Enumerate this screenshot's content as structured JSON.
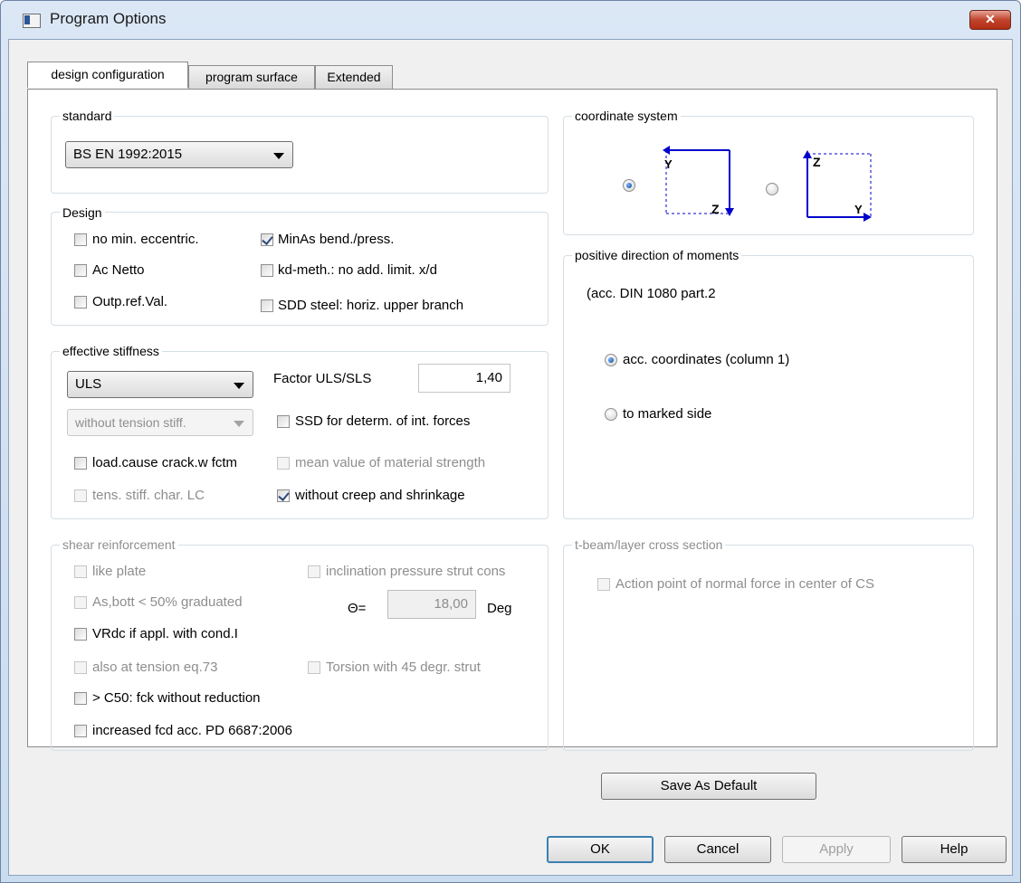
{
  "window": {
    "title": "Program Options",
    "close_label": "✕"
  },
  "tabs": [
    {
      "label": "design configuration"
    },
    {
      "label": "program surface"
    },
    {
      "label": "Extended"
    }
  ],
  "standard": {
    "label": "standard",
    "value": "BS EN 1992:2015"
  },
  "design": {
    "label": "Design",
    "items": [
      {
        "label": "no min. eccentric.",
        "checked": false
      },
      {
        "label": "MinAs bend./press.",
        "checked": true
      },
      {
        "label": "Ac Netto",
        "checked": false
      },
      {
        "label": "kd-meth.: no add. limit. x/d",
        "checked": false
      },
      {
        "label": "Outp.ref.Val.",
        "checked": false
      },
      {
        "label": "SDD steel: horiz. upper branch",
        "checked": false
      }
    ]
  },
  "effective_stiffness": {
    "label": "effective stiffness",
    "combo1": "ULS",
    "factor_label": "Factor ULS/SLS",
    "factor_value": "1,40",
    "combo2": "without tension stiff.",
    "items": [
      {
        "label": "SSD for determ. of int. forces",
        "checked": false
      },
      {
        "label": "load.cause crack.w fctm",
        "checked": false
      },
      {
        "label": "mean value of material strength",
        "checked": false
      },
      {
        "label": "tens. stiff. char. LC",
        "checked": false
      },
      {
        "label": "without creep and shrinkage",
        "checked": true
      }
    ]
  },
  "shear": {
    "label": "shear reinforcement",
    "items": [
      {
        "label": "like plate",
        "checked": false
      },
      {
        "label": "inclination pressure strut cons",
        "checked": false
      },
      {
        "label": "As,bott < 50% graduated",
        "checked": false
      },
      {
        "label": "VRdc if appl. with cond.I",
        "checked": false
      },
      {
        "label": "also at tension eq.73",
        "checked": false
      },
      {
        "label": "Torsion with 45 degr. strut",
        "checked": false
      },
      {
        "label": "> C50: fck without reduction",
        "checked": false
      },
      {
        "label": "increased fcd acc. PD 6687:2006",
        "checked": false
      }
    ],
    "theta_label": "Θ=",
    "theta_value": "18,00",
    "theta_unit": "Deg"
  },
  "coordinate_system": {
    "label": "coordinate system",
    "option1": {
      "axis_top": "Y",
      "axis_bottom": "Z",
      "selected": true
    },
    "option2": {
      "axis_top": "Z",
      "axis_bottom": "Y",
      "selected": false
    }
  },
  "moments": {
    "label": "positive direction of moments",
    "reference": "(acc.  DIN 1080 part.2",
    "option1": "acc. coordinates (column 1)",
    "option2": "to  marked side",
    "selected": "option1"
  },
  "tbeam": {
    "label": "t-beam/layer cross section",
    "item": "Action point of normal force in center of CS"
  },
  "buttons": {
    "save_default": "Save As Default",
    "ok": "OK",
    "cancel": "Cancel",
    "apply": "Apply",
    "help": "Help"
  },
  "colors": {
    "axis": "#0000cc",
    "accent": "#3c7fb1"
  }
}
